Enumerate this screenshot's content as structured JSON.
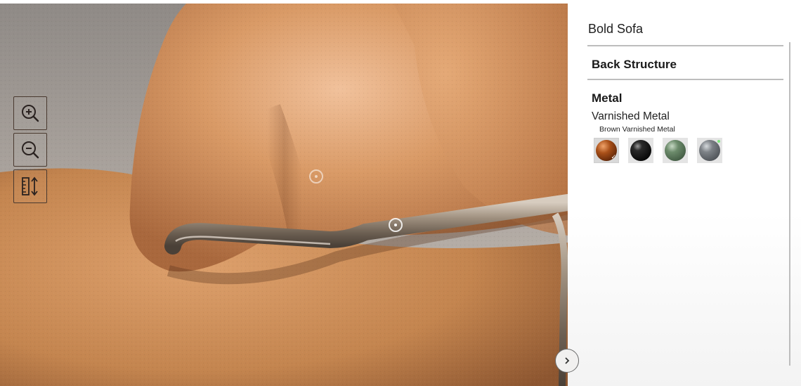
{
  "viewer": {
    "tools": [
      {
        "name": "zoom-in",
        "icon": "zoom-in-icon"
      },
      {
        "name": "zoom-out",
        "icon": "zoom-out-icon"
      },
      {
        "name": "measure",
        "icon": "ruler-icon"
      }
    ],
    "next_icon": "chevron-right-icon"
  },
  "panel": {
    "product_title": "Bold Sofa",
    "sections": [
      {
        "title": "Back Structure"
      },
      {
        "title": "Metal"
      }
    ],
    "material_group": "Varnished Metal",
    "selected_material": "Brown Varnished Metal",
    "swatches": [
      {
        "name": "brown",
        "color": "#8a3e12",
        "selected": true
      },
      {
        "name": "black",
        "color": "#111111",
        "selected": false
      },
      {
        "name": "green",
        "color": "#5b7a5e",
        "selected": false
      },
      {
        "name": "grey",
        "color": "#6f7378",
        "selected": false
      }
    ]
  },
  "colors": {
    "leather": "#c98a57",
    "metal": "#7d7062",
    "panel_rule": "#bdbdbd"
  }
}
